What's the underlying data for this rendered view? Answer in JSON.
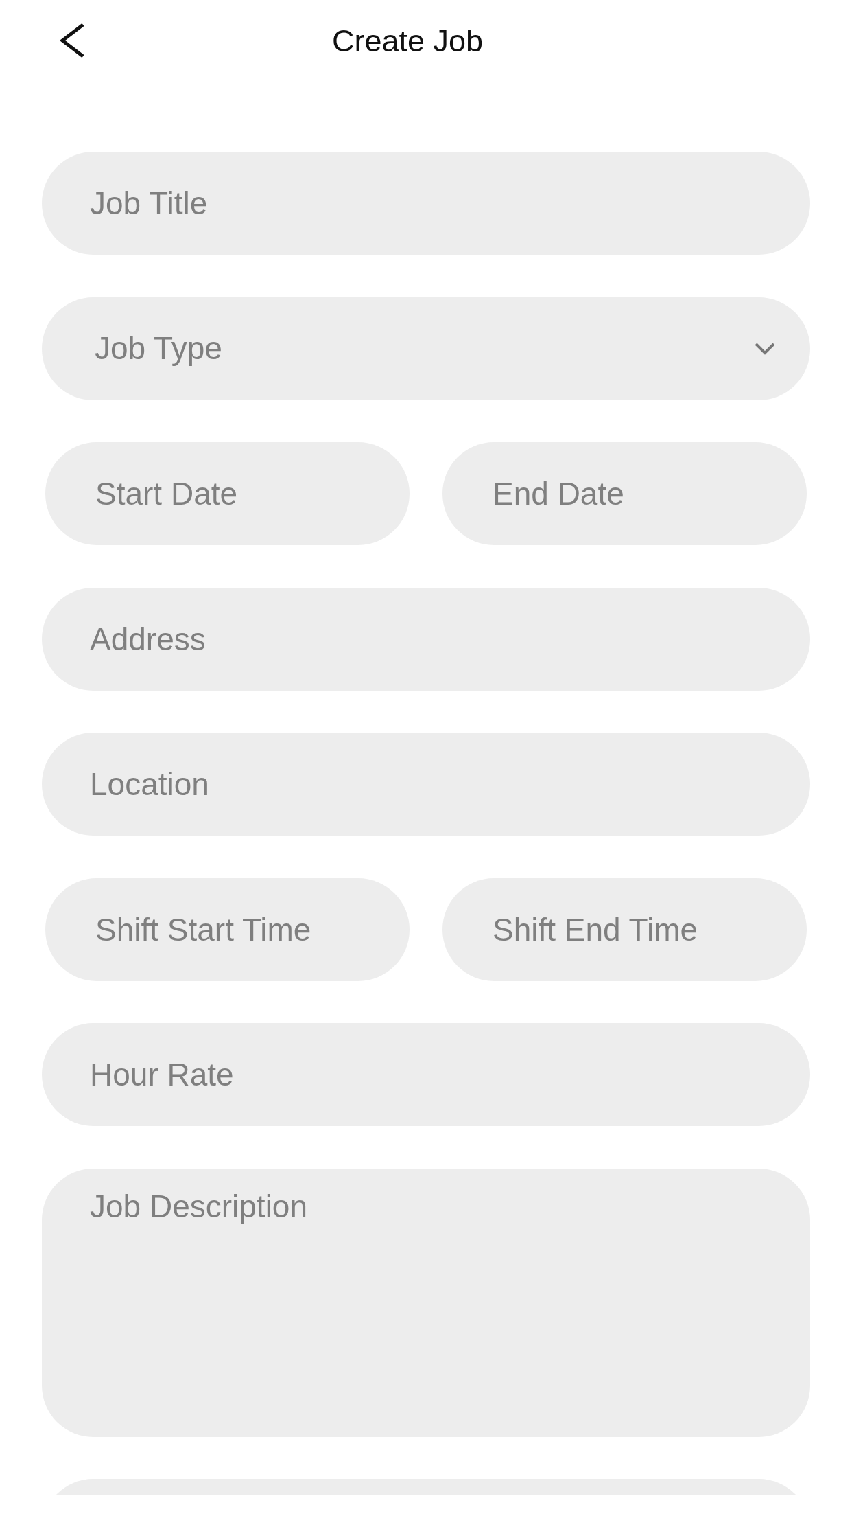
{
  "header": {
    "title": "Create Job"
  },
  "form": {
    "fields": [
      {
        "kind": "input",
        "placeholder": "Job Title"
      },
      {
        "kind": "select",
        "placeholder": "Job Type"
      },
      {
        "kind": "row",
        "items": [
          {
            "placeholder": "Start Date"
          },
          {
            "placeholder": "End Date"
          }
        ]
      },
      {
        "kind": "input",
        "placeholder": "Address"
      },
      {
        "kind": "input",
        "placeholder": "Location"
      },
      {
        "kind": "row",
        "items": [
          {
            "placeholder": "Shift Start Time"
          },
          {
            "placeholder": "Shift End Time"
          }
        ]
      },
      {
        "kind": "input",
        "placeholder": "Hour Rate"
      },
      {
        "kind": "textarea",
        "placeholder": "Job Description"
      },
      {
        "kind": "input"
      }
    ]
  }
}
